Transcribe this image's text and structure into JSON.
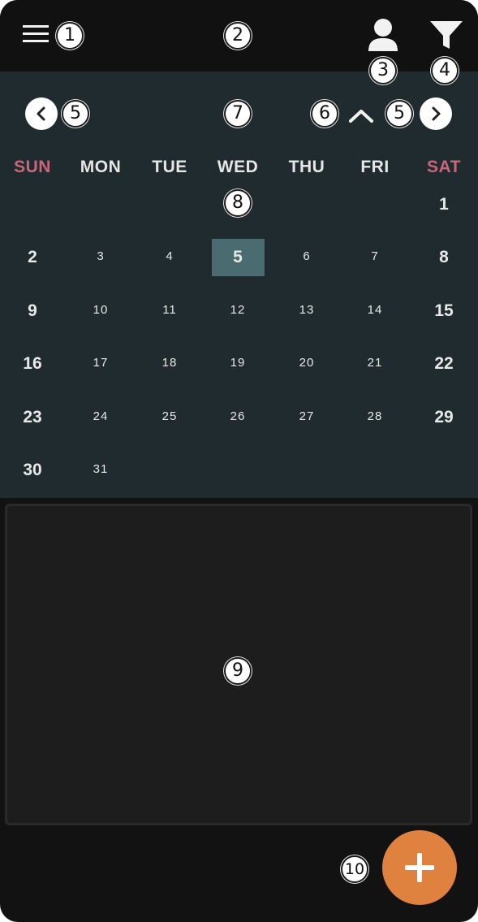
{
  "badges": {
    "b1": "1",
    "b2": "2",
    "b3": "3",
    "b4": "4",
    "b5a": "5",
    "b5b": "5",
    "b6": "6",
    "b7": "7",
    "b8": "8",
    "b9": "9",
    "b10": "10"
  },
  "calendar": {
    "weekdays": [
      "SUN",
      "MON",
      "TUE",
      "WED",
      "THU",
      "FRI",
      "SAT"
    ],
    "weeks": [
      [
        "",
        "",
        "",
        "",
        "",
        "",
        "1"
      ],
      [
        "2",
        "3",
        "4",
        "5",
        "6",
        "7",
        "8"
      ],
      [
        "9",
        "10",
        "11",
        "12",
        "13",
        "14",
        "15"
      ],
      [
        "16",
        "17",
        "18",
        "19",
        "20",
        "21",
        "22"
      ],
      [
        "23",
        "24",
        "25",
        "26",
        "27",
        "28",
        "29"
      ],
      [
        "30",
        "31",
        "",
        "",
        "",
        "",
        ""
      ]
    ],
    "selected_day": "5",
    "weekend_color": "#c9677a",
    "selected_color": "#4a6b6f"
  },
  "icons": {
    "menu": "menu-icon",
    "user": "user-icon",
    "filter": "filter-icon",
    "prev": "chevron-left-icon",
    "next": "chevron-right-icon",
    "collapse": "chevron-up-icon",
    "add": "plus-icon"
  },
  "colors": {
    "accent": "#e0823f",
    "calendar_bg": "#1f2b2f",
    "app_bg": "#121212"
  }
}
